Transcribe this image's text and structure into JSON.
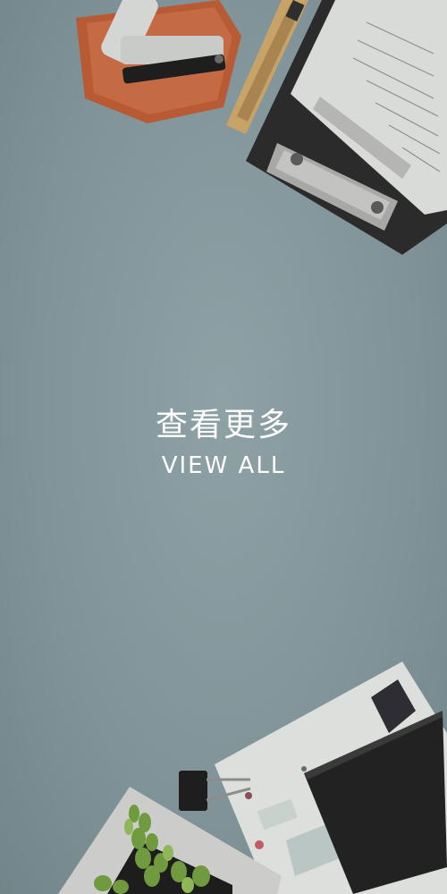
{
  "banner": {
    "title_cn": "查看更多",
    "title_en": "VIEW ALL"
  },
  "colors": {
    "background": "#7e9195",
    "text": "#ffffff"
  },
  "icons": [
    "pencil-cup-icon",
    "cutter-knife-icon",
    "clipboard-icon",
    "binder-clip-icon",
    "notebook-icon",
    "plant-icon",
    "photo-frame-icon"
  ]
}
